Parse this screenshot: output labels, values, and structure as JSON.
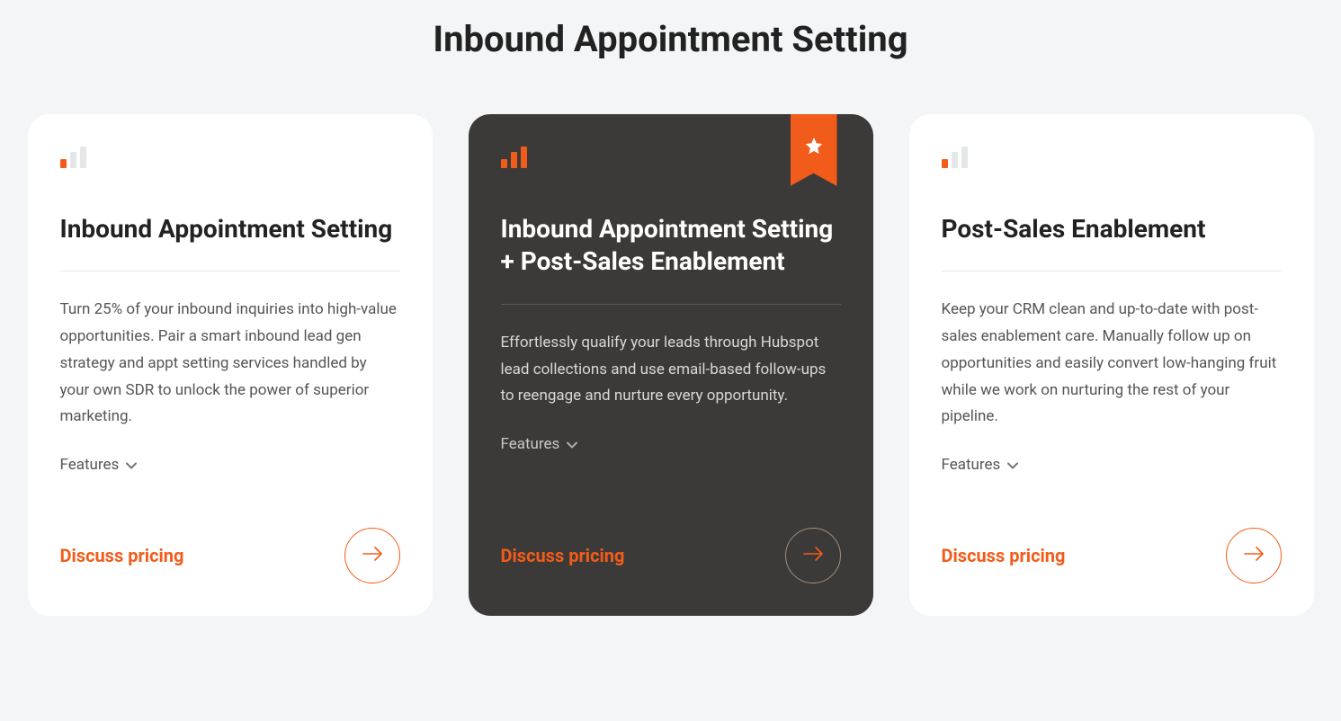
{
  "page_title": "Inbound Appointment Setting",
  "cards": [
    {
      "title": "Inbound Appointment Setting",
      "description": "Turn 25% of your inbound inquiries into high-value opportunities. Pair a smart inbound lead gen strategy and appt setting services handled by your own SDR to unlock the power of superior marketing.",
      "features_label": "Features",
      "cta_label": "Discuss pricing",
      "featured": false
    },
    {
      "title": "Inbound Appointment Setting + Post-Sales Enablement",
      "description": "Effortlessly qualify your leads through Hubspot lead collections and use email-based follow-ups to reengage and nurture every opportunity.",
      "features_label": "Features",
      "cta_label": "Discuss pricing",
      "featured": true
    },
    {
      "title": "Post-Sales Enablement",
      "description": "Keep your CRM clean and up-to-date with post-sales enablement care. Manually follow up on opportunities and easily convert low-hanging fruit while we work on nurturing the rest of your pipeline.",
      "features_label": "Features",
      "cta_label": "Discuss pricing",
      "featured": false
    }
  ],
  "colors": {
    "accent": "#f25c1a",
    "dark_card": "#3c3a38"
  }
}
